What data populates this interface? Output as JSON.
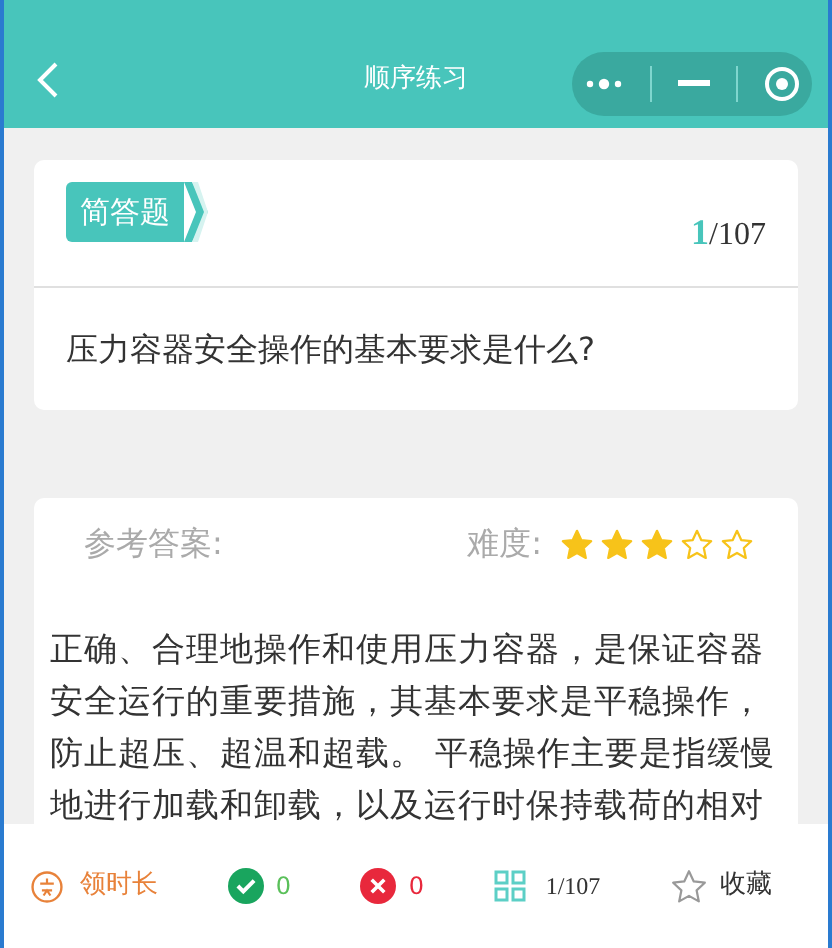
{
  "nav": {
    "title": "顺序练习"
  },
  "question": {
    "type": "简答题",
    "current": "1",
    "total": "/107",
    "text": "压力容器安全操作的基本要求是什么?"
  },
  "answer": {
    "label": "参考答案:",
    "difficulty_label": "难度:",
    "stars": 3,
    "text": "正确、合理地操作和使用压力容器，是保证容器安全运行的重要措施，其基本要求是平稳操作，防止超压、超温和超载。 平稳操作主要是指缓慢地进行加载和卸载，以及运行时保持载荷的相对"
  },
  "bottom_bar": [
    {
      "kind": "timer",
      "label": "领时长"
    },
    {
      "kind": "correct",
      "label": "0"
    },
    {
      "kind": "wrong",
      "label": "0"
    },
    {
      "kind": "progress",
      "label": "1/107"
    },
    {
      "kind": "favorite",
      "label": "收藏"
    }
  ]
}
